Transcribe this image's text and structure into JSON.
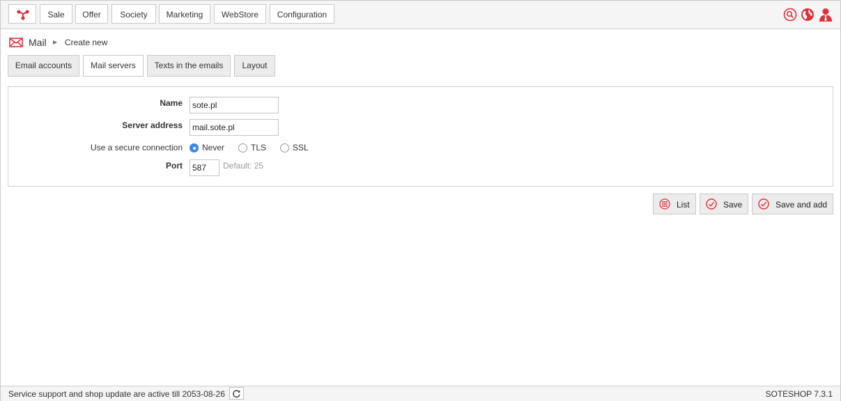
{
  "nav": {
    "items": [
      {
        "label": "Sale"
      },
      {
        "label": "Offer"
      },
      {
        "label": "Society"
      },
      {
        "label": "Marketing"
      },
      {
        "label": "WebStore"
      },
      {
        "label": "Configuration"
      }
    ],
    "icons": [
      "search-icon",
      "globe-icon",
      "user-icon"
    ]
  },
  "breadcrumb": {
    "section": "Mail",
    "current": "Create new"
  },
  "tabs": [
    {
      "label": "Email accounts"
    },
    {
      "label": "Mail servers",
      "active": true
    },
    {
      "label": "Texts in the emails"
    },
    {
      "label": "Layout"
    }
  ],
  "form": {
    "name_label": "Name",
    "name_value": "sote.pl",
    "server_label": "Server address",
    "server_value": "mail.sote.pl",
    "secure_label": "Use a secure connection",
    "secure_options": [
      {
        "label": "Never",
        "selected": true
      },
      {
        "label": "TLS",
        "selected": false
      },
      {
        "label": "SSL",
        "selected": false
      }
    ],
    "port_label": "Port",
    "port_value": "587",
    "port_hint": "Default: 25"
  },
  "actions": {
    "list": "List",
    "save": "Save",
    "save_add": "Save and add"
  },
  "footer": {
    "support": "Service support and shop update are active till 2053-08-26",
    "version": "SOTESHOP 7.3.1"
  },
  "colors": {
    "accent": "#e0303a",
    "radio": "#3b86e6"
  }
}
